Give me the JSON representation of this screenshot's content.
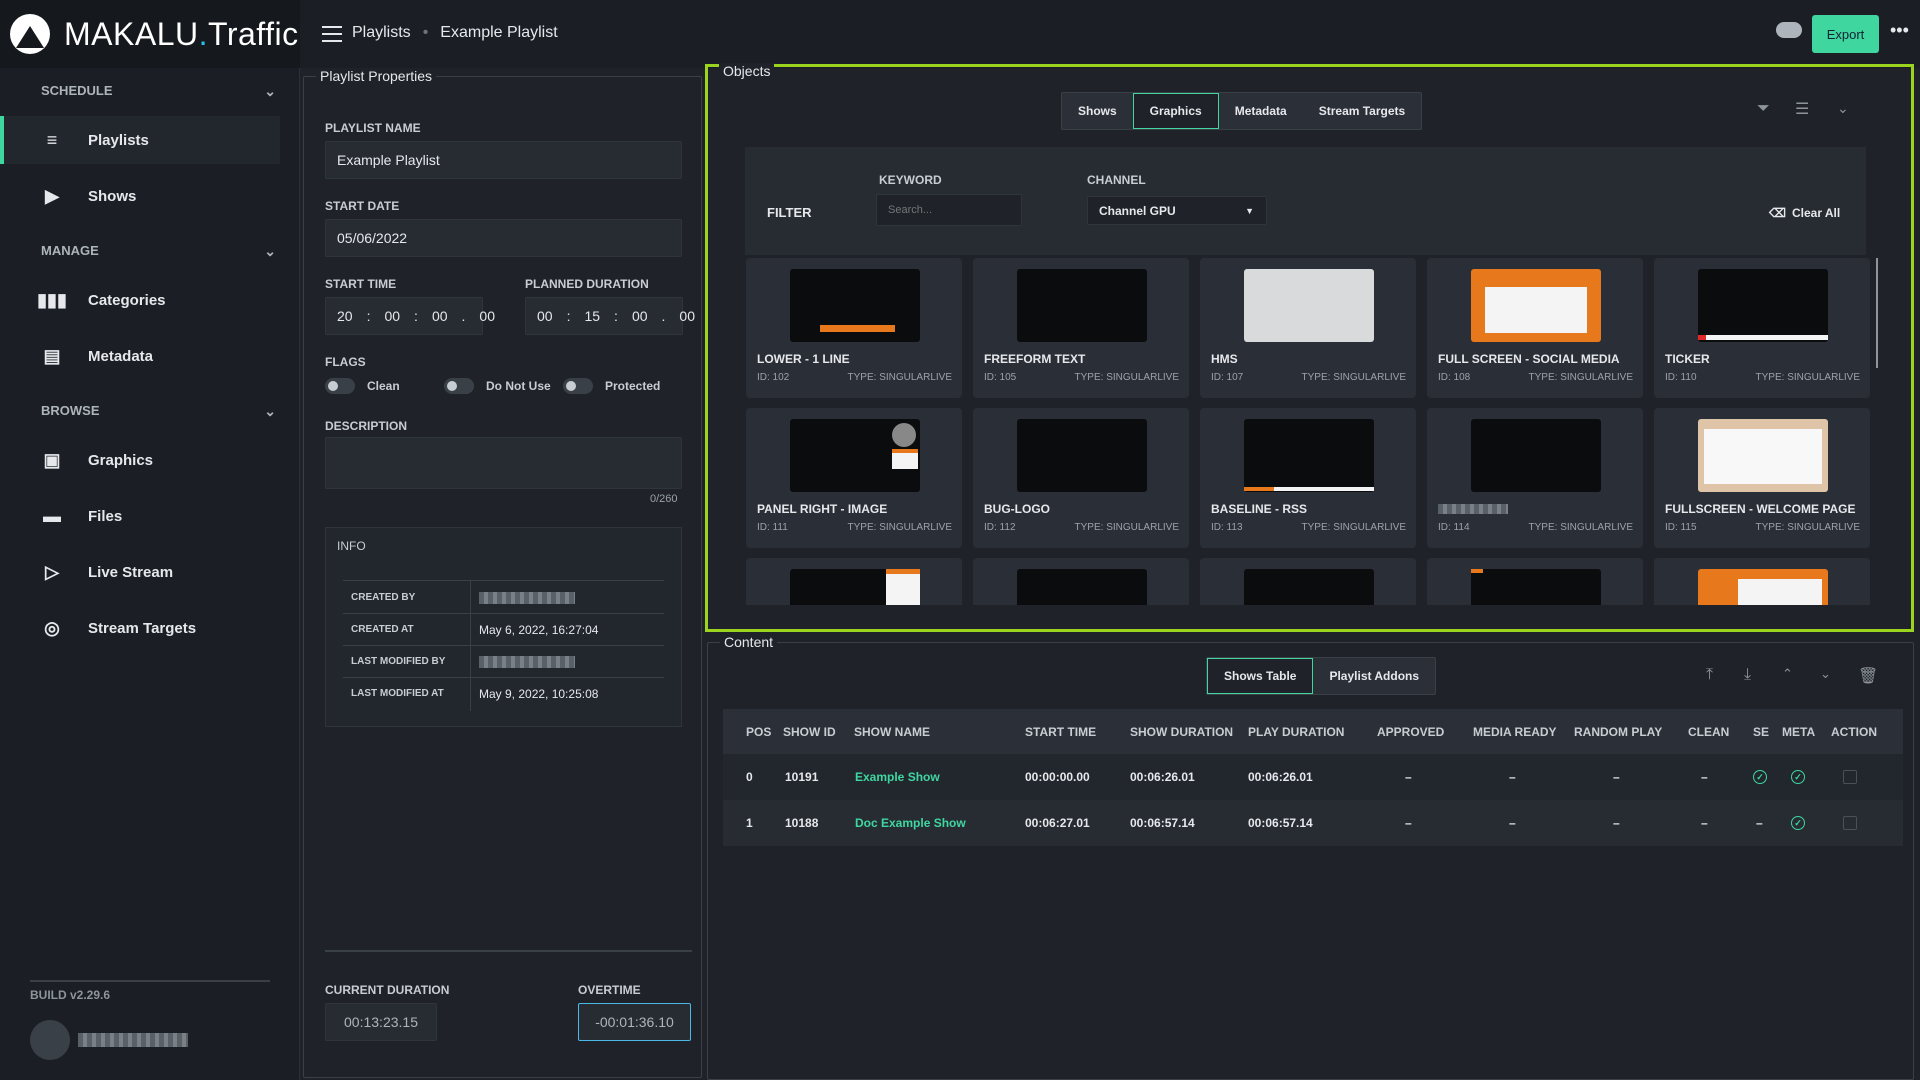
{
  "app": {
    "logo_main": "MAKALU",
    "logo_dot": ".",
    "logo_sub": "Traffic",
    "build": "BUILD v2.29.6"
  },
  "sidebar": {
    "sections": [
      {
        "label": "SCHEDULE"
      },
      {
        "label": "MANAGE"
      },
      {
        "label": "BROWSE"
      }
    ],
    "items": [
      {
        "label": "Playlists",
        "icon": "playlist-icon"
      },
      {
        "label": "Shows",
        "icon": "play-icon"
      },
      {
        "label": "Categories",
        "icon": "columns-icon"
      },
      {
        "label": "Metadata",
        "icon": "document-icon"
      },
      {
        "label": "Graphics",
        "icon": "image-icon"
      },
      {
        "label": "Files",
        "icon": "folder-icon"
      },
      {
        "label": "Live Stream",
        "icon": "live-icon"
      },
      {
        "label": "Stream Targets",
        "icon": "target-icon"
      }
    ]
  },
  "header": {
    "crumb1": "Playlists",
    "sep": "•",
    "crumb2": "Example Playlist",
    "export": "Export",
    "more": "•••"
  },
  "props": {
    "title": "Playlist Properties",
    "name_label": "PLAYLIST NAME",
    "name": "Example Playlist",
    "date_label": "START DATE",
    "date": "05/06/2022",
    "time_label": "START TIME",
    "time": [
      "20",
      ":",
      "00",
      ":",
      "00",
      ".",
      "00"
    ],
    "dur_label": "PLANNED DURATION",
    "dur": [
      "00",
      ":",
      "15",
      ":",
      "00",
      ".",
      "00"
    ],
    "flags_label": "FLAGS",
    "flags": [
      "Clean",
      "Do Not Use",
      "Protected"
    ],
    "desc_label": "DESCRIPTION",
    "desc_count": "0/260",
    "info_label": "INFO",
    "info": [
      {
        "k": "CREATED BY",
        "v": ""
      },
      {
        "k": "CREATED AT",
        "v": "May 6, 2022, 16:27:04"
      },
      {
        "k": "LAST MODIFIED BY",
        "v": ""
      },
      {
        "k": "LAST MODIFIED AT",
        "v": "May 9, 2022, 10:25:08"
      }
    ],
    "cur_label": "CURRENT DURATION",
    "cur": "00:13:23.15",
    "over_label": "OVERTIME",
    "over": "-00:01:36.10"
  },
  "objects": {
    "title": "Objects",
    "tabs": [
      "Shows",
      "Graphics",
      "Metadata",
      "Stream Targets"
    ],
    "filter": "FILTER",
    "kw_label": "KEYWORD",
    "kw_placeholder": "Search...",
    "ch_label": "CHANNEL",
    "channel": "Channel GPU",
    "clear": "Clear All",
    "cards": [
      {
        "t": "LOWER - 1 LINE",
        "id": "ID: 102",
        "ty": "TYPE: SINGULARLIVE"
      },
      {
        "t": "FREEFORM TEXT",
        "id": "ID: 105",
        "ty": "TYPE: SINGULARLIVE"
      },
      {
        "t": "HMS",
        "id": "ID: 107",
        "ty": "TYPE: SINGULARLIVE"
      },
      {
        "t": "FULL SCREEN - SOCIAL MEDIA",
        "id": "ID: 108",
        "ty": "TYPE: SINGULARLIVE"
      },
      {
        "t": "TICKER",
        "id": "ID: 110",
        "ty": "TYPE: SINGULARLIVE"
      },
      {
        "t": "PANEL RIGHT - IMAGE",
        "id": "ID: 111",
        "ty": "TYPE: SINGULARLIVE"
      },
      {
        "t": "BUG-LOGO",
        "id": "ID: 112",
        "ty": "TYPE: SINGULARLIVE"
      },
      {
        "t": "BASELINE - RSS",
        "id": "ID: 113",
        "ty": "TYPE: SINGULARLIVE"
      },
      {
        "t": "",
        "id": "ID: 114",
        "ty": "TYPE: SINGULARLIVE"
      },
      {
        "t": "FULLSCREEN - WELCOME PAGE",
        "id": "ID: 115",
        "ty": "TYPE: SINGULARLIVE"
      }
    ]
  },
  "content": {
    "title": "Content",
    "tabs": [
      "Shows Table",
      "Playlist Addons"
    ],
    "cols": [
      "POS",
      "SHOW ID",
      "SHOW NAME",
      "START TIME",
      "SHOW DURATION",
      "PLAY DURATION",
      "APPROVED",
      "MEDIA READY",
      "RANDOM PLAY",
      "CLEAN",
      "SE",
      "META",
      "ACTION"
    ],
    "rows": [
      {
        "pos": "0",
        "id": "10191",
        "name": "Example Show",
        "start": "00:00:00.00",
        "sdur": "00:06:26.01",
        "pdur": "00:06:26.01",
        "ap": "–",
        "mr": "–",
        "rp": "–",
        "cl": "–"
      },
      {
        "pos": "1",
        "id": "10188",
        "name": "Doc Example Show",
        "start": "00:06:27.01",
        "sdur": "00:06:57.14",
        "pdur": "00:06:57.14",
        "ap": "–",
        "mr": "–",
        "rp": "–",
        "cl": "–",
        "se": "–"
      }
    ]
  }
}
